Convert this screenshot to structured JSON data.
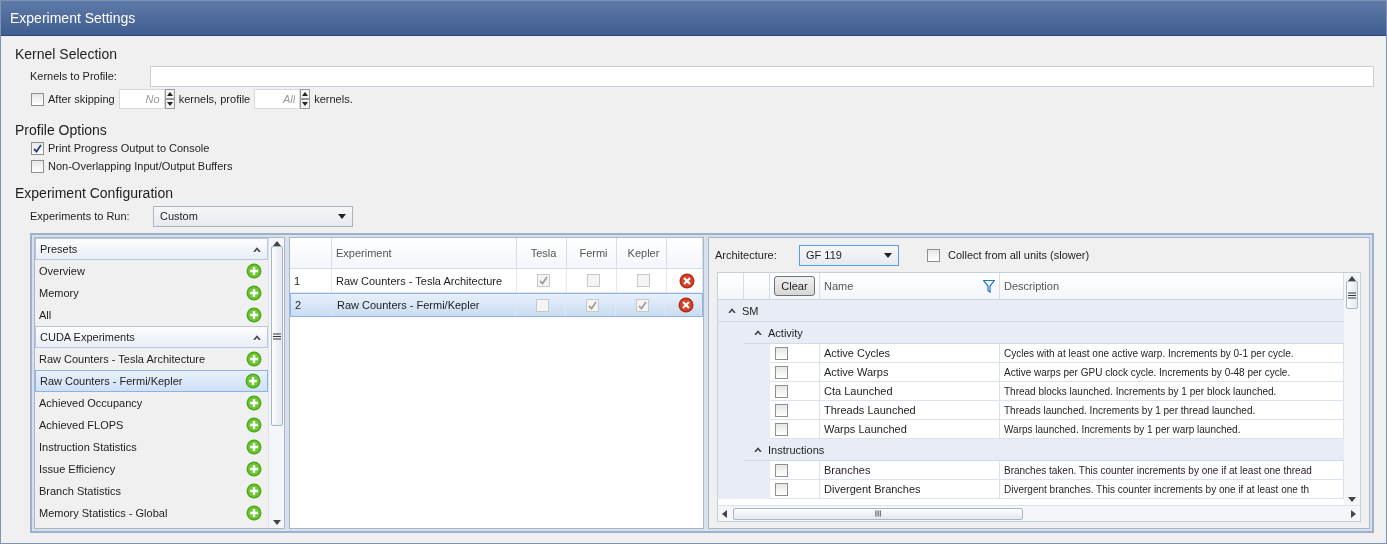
{
  "window": {
    "title": "Experiment Settings"
  },
  "kernel_selection": {
    "heading": "Kernel Selection",
    "kernels_label": "Kernels to Profile:",
    "skip": {
      "checked": false,
      "label_before": "After skipping",
      "skip_placeholder": "No",
      "label_middle": "kernels, profile",
      "profile_placeholder": "All",
      "label_after": "kernels."
    }
  },
  "profile_options": {
    "heading": "Profile Options",
    "options": [
      {
        "label": "Print Progress Output to Console",
        "checked": true
      },
      {
        "label": "Non-Overlapping Input/Output Buffers",
        "checked": false
      }
    ]
  },
  "experiment_configuration": {
    "heading": "Experiment Configuration",
    "run_label": "Experiments to Run:",
    "run_value": "Custom"
  },
  "presets": {
    "groups": [
      {
        "title": "Presets",
        "expanded": true,
        "items": [
          {
            "label": "Overview",
            "selected": false
          },
          {
            "label": "Memory",
            "selected": false
          },
          {
            "label": "All",
            "selected": false
          }
        ]
      },
      {
        "title": "CUDA Experiments",
        "expanded": true,
        "items": [
          {
            "label": "Raw Counters - Tesla Architecture",
            "selected": false
          },
          {
            "label": "Raw Counters - Fermi/Kepler",
            "selected": true
          },
          {
            "label": "Achieved Occupancy",
            "selected": false
          },
          {
            "label": "Achieved FLOPS",
            "selected": false
          },
          {
            "label": "Instruction Statistics",
            "selected": false
          },
          {
            "label": "Issue Efficiency",
            "selected": false
          },
          {
            "label": "Branch Statistics",
            "selected": false
          },
          {
            "label": "Memory Statistics - Global",
            "selected": false
          }
        ]
      }
    ]
  },
  "experiments_table": {
    "columns": [
      "Experiment",
      "Tesla",
      "Fermi",
      "Kepler"
    ],
    "rows": [
      {
        "index": "1",
        "name": "Raw Counters - Tesla Architecture",
        "checks": [
          true,
          false,
          false
        ],
        "selected": false
      },
      {
        "index": "2",
        "name": "Raw Counters - Fermi/Kepler",
        "checks": [
          false,
          true,
          true
        ],
        "selected": true
      }
    ]
  },
  "metrics": {
    "architecture_label": "Architecture:",
    "architecture_value": "GF 119",
    "collect_all": {
      "label": "Collect from all units (slower)",
      "checked": false
    },
    "clear_button": "Clear",
    "columns": [
      "Name",
      "Description"
    ],
    "groups": [
      {
        "title": "SM",
        "expanded": true,
        "children": [
          {
            "title": "Activity",
            "expanded": true,
            "rows": [
              {
                "name": "Active Cycles",
                "description": "Cycles with at least one active warp. Increments by 0-1 per cycle.",
                "checked": false
              },
              {
                "name": "Active Warps",
                "description": "Active warps per GPU clock cycle. Increments by 0-48 per cycle.",
                "checked": false
              },
              {
                "name": "Cta Launched",
                "description": "Thread blocks launched. Increments by 1 per block launched.",
                "checked": false
              },
              {
                "name": "Threads Launched",
                "description": "Threads launched. Increments by 1 per thread launched.",
                "checked": false
              },
              {
                "name": "Warps Launched",
                "description": "Warps launched. Increments by 1 per warp launched.",
                "checked": false
              }
            ]
          },
          {
            "title": "Instructions",
            "expanded": true,
            "rows": [
              {
                "name": "Branches",
                "description": "Branches taken. This counter increments by one if at least one thread",
                "checked": false
              },
              {
                "name": "Divergent Branches",
                "description": "Divergent branches. This counter increments by one if at least one th",
                "checked": false
              }
            ]
          }
        ]
      }
    ]
  }
}
